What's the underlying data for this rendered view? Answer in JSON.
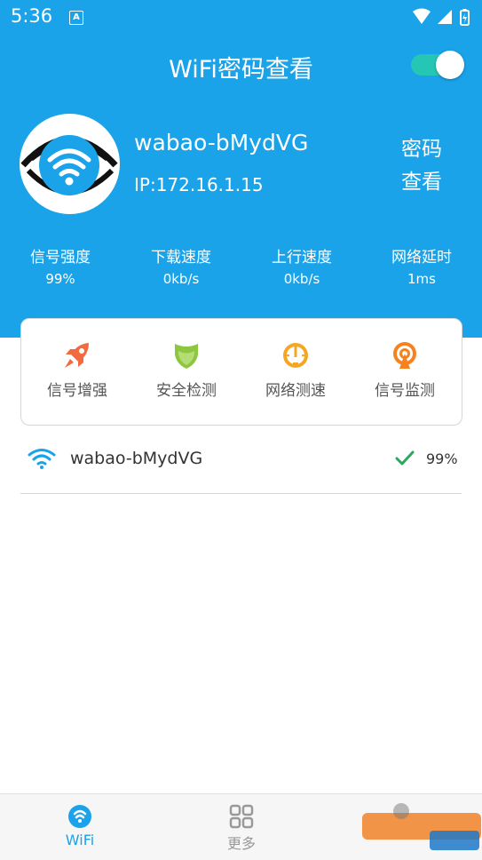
{
  "status_bar": {
    "time": "5:36",
    "notification_icon": "A"
  },
  "app": {
    "title": "WiFi密码查看"
  },
  "toggle": {
    "on": true
  },
  "connection": {
    "name": "wabao-bMydVG",
    "ip": "IP:172.16.1.15",
    "password_button": [
      "密码",
      "查看"
    ]
  },
  "stats": [
    {
      "label": "信号强度",
      "value": "99%"
    },
    {
      "label": "下载速度",
      "value": "0kb/s"
    },
    {
      "label": "上行速度",
      "value": "0kb/s"
    },
    {
      "label": "网络延时",
      "value": "1ms"
    }
  ],
  "tools": [
    {
      "label": "信号增强",
      "icon": "rocket-icon",
      "color": "#f26a3f"
    },
    {
      "label": "安全检测",
      "icon": "shield-icon",
      "color": "#8dc63f"
    },
    {
      "label": "网络测速",
      "icon": "speedometer-icon",
      "color": "#f5a623"
    },
    {
      "label": "信号监测",
      "icon": "antenna-signal-icon",
      "color": "#f5821f"
    }
  ],
  "wifi_list": [
    {
      "name": "wabao-bMydVG",
      "signal": "99%",
      "connected": true
    }
  ],
  "bottom_nav": [
    {
      "label": "WiFi",
      "active": true,
      "icon": "wifi-tab-icon"
    },
    {
      "label": "更多",
      "active": false,
      "icon": "grid-icon"
    }
  ],
  "colors": {
    "primary": "#1aa3e8",
    "toggle": "#26c6b5",
    "check": "#2aa85f"
  }
}
